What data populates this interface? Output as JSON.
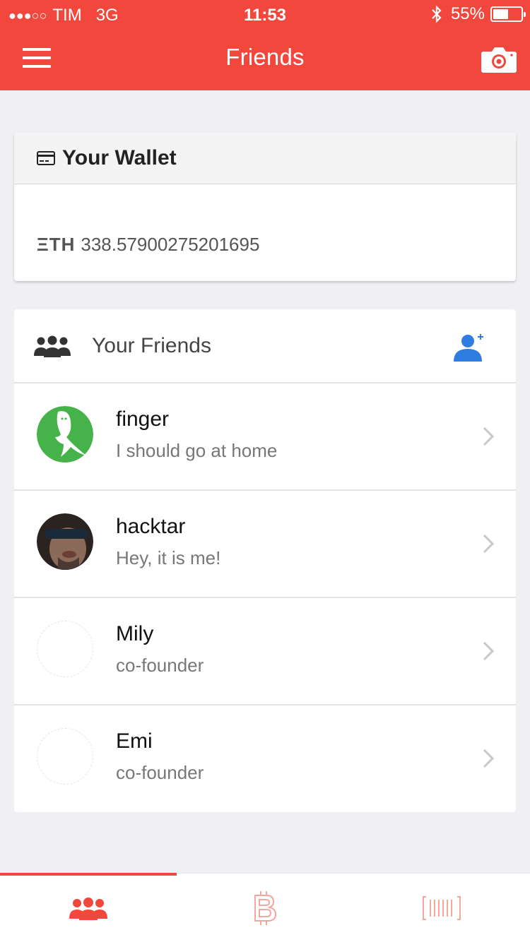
{
  "status_bar": {
    "signal": "●●●○○",
    "carrier": "TIM",
    "network": "3G",
    "time": "11:53",
    "bluetooth_icon": "bluetooth-icon",
    "battery_percent": "55%",
    "battery_level": 0.55
  },
  "header": {
    "title": "Friends",
    "menu_icon": "hamburger-menu-icon",
    "camera_icon": "camera-icon",
    "background_color": "#f2473c"
  },
  "wallet": {
    "title": "Your Wallet",
    "icon": "credit-card-icon",
    "currency_symbol": "ΞTH",
    "balance": "338.57900275201695"
  },
  "friends": {
    "title": "Your Friends",
    "icon": "group-icon",
    "add_icon": "add-friend-icon",
    "accent_color": "#2f7de1",
    "items": [
      {
        "name": "finger",
        "status": "I should go at home",
        "avatar": "ghost-avatar"
      },
      {
        "name": "hacktar",
        "status": "Hey, it is me!",
        "avatar": "photo-avatar"
      },
      {
        "name": "Mily",
        "status": "co-founder",
        "avatar": "blank-avatar"
      },
      {
        "name": "Emi",
        "status": "co-founder",
        "avatar": "blank-avatar"
      }
    ]
  },
  "tabbar": {
    "tabs": [
      {
        "icon": "friends-tab-icon",
        "active": true
      },
      {
        "icon": "bitcoin-tab-icon",
        "active": false
      },
      {
        "icon": "barcode-tab-icon",
        "active": false
      }
    ]
  }
}
